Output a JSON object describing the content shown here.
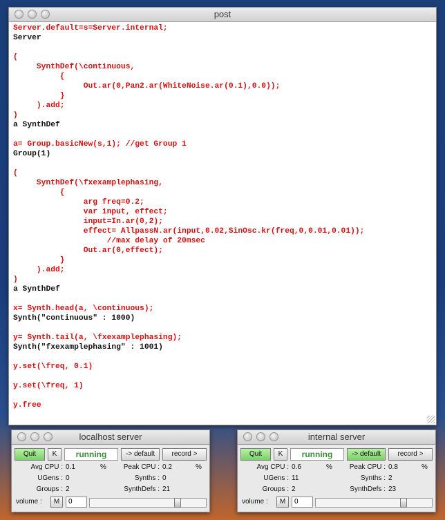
{
  "post": {
    "title": "post",
    "lines": [
      {
        "text": "Server.default=s=Server.internal;",
        "color": "red"
      },
      {
        "text": "Server",
        "color": "black"
      },
      {
        "text": "",
        "color": "black"
      },
      {
        "text": "(",
        "color": "red"
      },
      {
        "text": "     SynthDef(\\continuous,",
        "color": "red"
      },
      {
        "text": "          {",
        "color": "red"
      },
      {
        "text": "               Out.ar(0,Pan2.ar(WhiteNoise.ar(0.1),0.0));",
        "color": "red"
      },
      {
        "text": "          }",
        "color": "red"
      },
      {
        "text": "     ).add;",
        "color": "red"
      },
      {
        "text": ")",
        "color": "red"
      },
      {
        "text": "a SynthDef",
        "color": "black"
      },
      {
        "text": "",
        "color": "black"
      },
      {
        "text": "a= Group.basicNew(s,1); //get Group 1",
        "color": "red"
      },
      {
        "text": "Group(1)",
        "color": "black"
      },
      {
        "text": "",
        "color": "black"
      },
      {
        "text": "(",
        "color": "red"
      },
      {
        "text": "     SynthDef(\\fxexamplephasing,",
        "color": "red"
      },
      {
        "text": "          {",
        "color": "red"
      },
      {
        "text": "               arg freq=0.2;",
        "color": "red"
      },
      {
        "text": "               var input, effect;",
        "color": "red"
      },
      {
        "text": "               input=In.ar(0,2);",
        "color": "red"
      },
      {
        "text": "               effect= AllpassN.ar(input,0.02,SinOsc.kr(freq,0,0.01,0.01));",
        "color": "red"
      },
      {
        "text": "                    //max delay of 20msec",
        "color": "red"
      },
      {
        "text": "               Out.ar(0,effect);",
        "color": "red"
      },
      {
        "text": "          }",
        "color": "red"
      },
      {
        "text": "     ).add;",
        "color": "red"
      },
      {
        "text": ")",
        "color": "red"
      },
      {
        "text": "a SynthDef",
        "color": "black"
      },
      {
        "text": "",
        "color": "black"
      },
      {
        "text": "x= Synth.head(a, \\continuous);",
        "color": "red"
      },
      {
        "text": "Synth(\"continuous\" : 1000)",
        "color": "black"
      },
      {
        "text": "",
        "color": "black"
      },
      {
        "text": "y= Synth.tail(a, \\fxexamplephasing);",
        "color": "red"
      },
      {
        "text": "Synth(\"fxexamplephasing\" : 1001)",
        "color": "black"
      },
      {
        "text": "",
        "color": "black"
      },
      {
        "text": "y.set(\\freq, 0.1)",
        "color": "red"
      },
      {
        "text": "",
        "color": "black"
      },
      {
        "text": "y.set(\\freq, 1)",
        "color": "red"
      },
      {
        "text": "",
        "color": "black"
      },
      {
        "text": "y.free",
        "color": "red"
      }
    ]
  },
  "localhost": {
    "title": "localhost server",
    "quit": "Quit",
    "kill": "K",
    "status": "running",
    "default_btn": "-> default",
    "default_active": false,
    "record": "record >",
    "avg_cpu_label": "Avg CPU :",
    "avg_cpu": "0.1",
    "pct1": "%",
    "peak_cpu_label": "Peak CPU :",
    "peak_cpu": "0.2",
    "pct2": "%",
    "ugens_label": "UGens :",
    "ugens": "0",
    "synths_label": "Synths :",
    "synths": "0",
    "groups_label": "Groups :",
    "groups": "2",
    "synthdefs_label": "SynthDefs :",
    "synthdefs": "21",
    "volume_label": "volume :",
    "mute": "M",
    "volume": "0",
    "slider_level": 0.77
  },
  "internal": {
    "title": "internal server",
    "quit": "Quit",
    "kill": "K",
    "status": "running",
    "default_btn": "-> default",
    "default_active": true,
    "record": "record >",
    "avg_cpu_label": "Avg CPU :",
    "avg_cpu": "0.6",
    "pct1": "%",
    "peak_cpu_label": "Peak CPU :",
    "peak_cpu": "0.8",
    "pct2": "%",
    "ugens_label": "UGens :",
    "ugens": "11",
    "synths_label": "Synths :",
    "synths": "2",
    "groups_label": "Groups :",
    "groups": "2",
    "synthdefs_label": "SynthDefs :",
    "synthdefs": "23",
    "volume_label": "volume :",
    "mute": "M",
    "volume": "0",
    "slider_level": 0.77
  }
}
